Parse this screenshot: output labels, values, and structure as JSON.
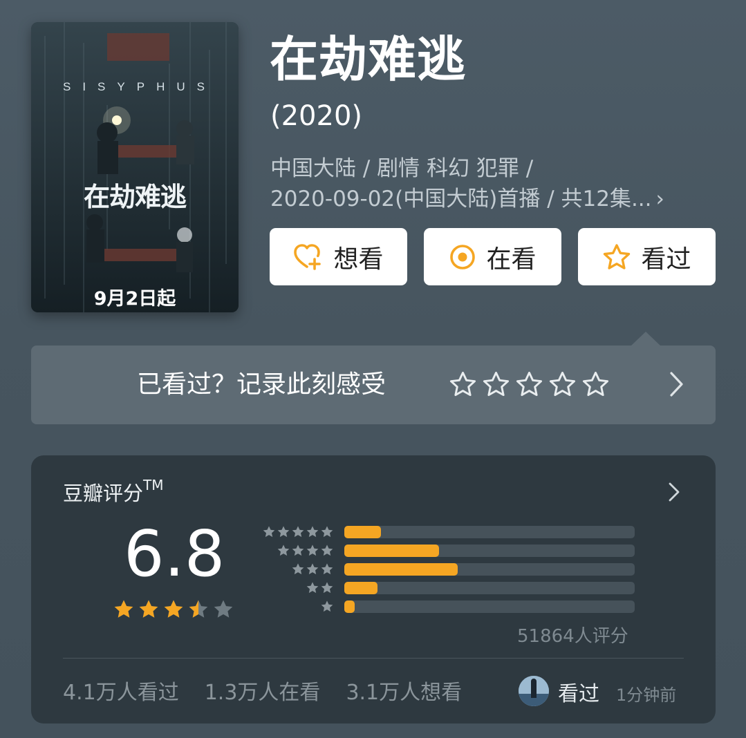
{
  "poster": {
    "english_title": "SISYPHUS",
    "chinese_title": "在劫难逃",
    "date_caption": "9月2日起"
  },
  "title": "在劫难逃",
  "year": "(2020)",
  "meta": {
    "line1": "中国大陆 / 剧情 科幻 犯罪 /",
    "line2": "2020-09-02(中国大陆)首播 / 共12集...",
    "chevron": "›"
  },
  "actions": {
    "want": "想看",
    "watching": "在看",
    "watched": "看过"
  },
  "record": {
    "prompt": "已看过？记录此刻感受"
  },
  "rating": {
    "title": "豆瓣评分",
    "tm": "TM",
    "score": "6.8",
    "stars": 3.5,
    "distribution": [
      {
        "stars": 5,
        "fraction": 0.125
      },
      {
        "stars": 4,
        "fraction": 0.325
      },
      {
        "stars": 3,
        "fraction": 0.39
      },
      {
        "stars": 2,
        "fraction": 0.115
      },
      {
        "stars": 1,
        "fraction": 0.035
      }
    ],
    "count": "51864人评分",
    "watched_count": "4.1万人看过",
    "watching_count": "1.3万人在看",
    "want_count": "3.1万人想看",
    "friend_action": "看过",
    "friend_time": "1分钟前"
  },
  "colors": {
    "accent": "#f5a623",
    "card": "#2e3940",
    "record_bar": "#5e6b74"
  }
}
